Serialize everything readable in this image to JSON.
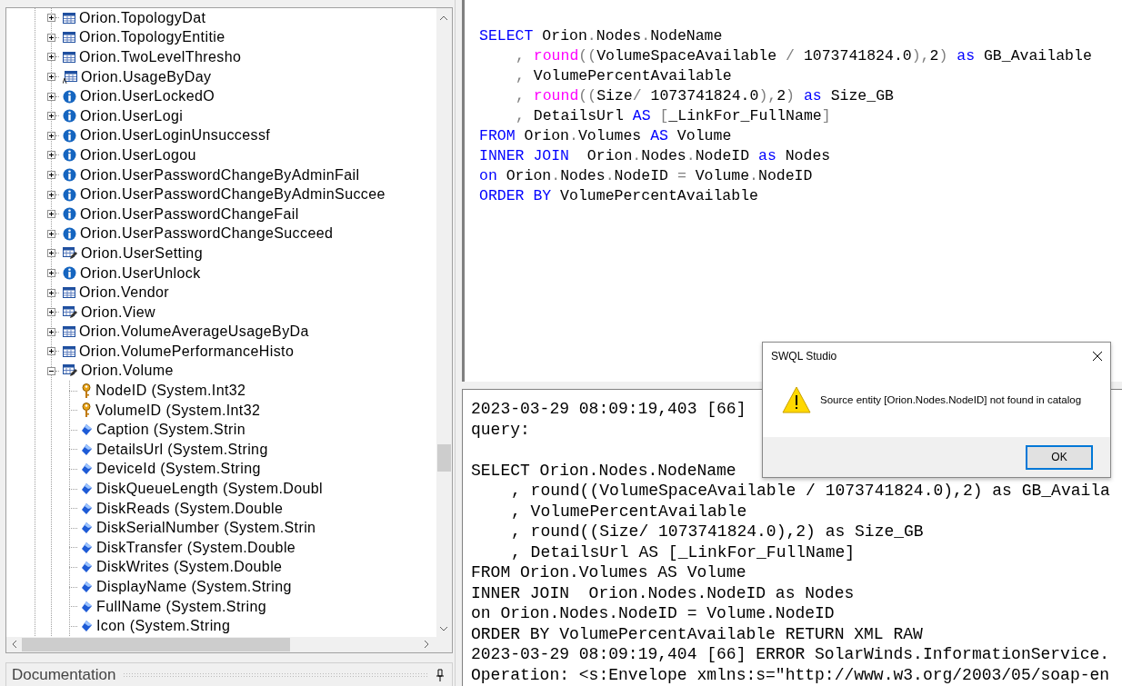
{
  "tree": {
    "items": [
      {
        "label": "Orion.TopologyDat",
        "kind": "table",
        "expanded": false
      },
      {
        "label": "Orion.TopologyEntitie",
        "kind": "table",
        "expanded": false
      },
      {
        "label": "Orion.TwoLevelThresho",
        "kind": "table",
        "expanded": false
      },
      {
        "label": "Orion.UsageByDay",
        "kind": "view",
        "expanded": false
      },
      {
        "label": "Orion.UserLockedO",
        "kind": "info",
        "expanded": false
      },
      {
        "label": "Orion.UserLogi",
        "kind": "info",
        "expanded": false
      },
      {
        "label": "Orion.UserLoginUnsuccessf",
        "kind": "info",
        "expanded": false
      },
      {
        "label": "Orion.UserLogou",
        "kind": "info",
        "expanded": false
      },
      {
        "label": "Orion.UserPasswordChangeByAdminFail",
        "kind": "info",
        "expanded": false
      },
      {
        "label": "Orion.UserPasswordChangeByAdminSuccee",
        "kind": "info",
        "expanded": false
      },
      {
        "label": "Orion.UserPasswordChangeFail",
        "kind": "info",
        "expanded": false
      },
      {
        "label": "Orion.UserPasswordChangeSucceed",
        "kind": "info",
        "expanded": false
      },
      {
        "label": "Orion.UserSetting",
        "kind": "edit",
        "expanded": false
      },
      {
        "label": "Orion.UserUnlock",
        "kind": "info",
        "expanded": false
      },
      {
        "label": "Orion.Vendor",
        "kind": "table",
        "expanded": false
      },
      {
        "label": "Orion.View",
        "kind": "edit",
        "expanded": false
      },
      {
        "label": "Orion.VolumeAverageUsageByDa",
        "kind": "table",
        "expanded": false
      },
      {
        "label": "Orion.VolumePerformanceHisto",
        "kind": "table",
        "expanded": false
      },
      {
        "label": "Orion.Volume",
        "kind": "edit",
        "expanded": true,
        "children": [
          {
            "label": "NodeID (System.Int32",
            "kind": "key"
          },
          {
            "label": "VolumeID (System.Int32",
            "kind": "key"
          },
          {
            "label": "Caption (System.Strin",
            "kind": "property"
          },
          {
            "label": "DetailsUrl (System.String",
            "kind": "property"
          },
          {
            "label": "DeviceId (System.String",
            "kind": "property"
          },
          {
            "label": "DiskQueueLength (System.Doubl",
            "kind": "property"
          },
          {
            "label": "DiskReads (System.Double",
            "kind": "property"
          },
          {
            "label": "DiskSerialNumber (System.Strin",
            "kind": "property"
          },
          {
            "label": "DiskTransfer (System.Double",
            "kind": "property"
          },
          {
            "label": "DiskWrites (System.Double",
            "kind": "property"
          },
          {
            "label": "DisplayName (System.String",
            "kind": "property"
          },
          {
            "label": "FullName (System.String",
            "kind": "property"
          },
          {
            "label": "Icon (System.String",
            "kind": "property"
          }
        ]
      }
    ]
  },
  "documentation": {
    "title": "Documentation"
  },
  "editor": {
    "lines": [
      {
        "indented": false,
        "tokens": [
          {
            "kind": "kw",
            "text": "SELECT"
          },
          {
            "kind": "id",
            "text": " Orion"
          },
          {
            "kind": "op",
            "text": "."
          },
          {
            "kind": "id",
            "text": "Nodes"
          },
          {
            "kind": "op",
            "text": "."
          },
          {
            "kind": "id",
            "text": "NodeName"
          }
        ]
      },
      {
        "indented": true,
        "tokens": [
          {
            "kind": "op",
            "text": ", "
          },
          {
            "kind": "fn",
            "text": "round"
          },
          {
            "kind": "op",
            "text": "(("
          },
          {
            "kind": "id",
            "text": "VolumeSpaceAvailable "
          },
          {
            "kind": "op",
            "text": "/"
          },
          {
            "kind": "id",
            "text": " 1073741824.0"
          },
          {
            "kind": "op",
            "text": "),"
          },
          {
            "kind": "id",
            "text": "2"
          },
          {
            "kind": "op",
            "text": ")"
          },
          {
            "kind": "kw",
            "text": " as"
          },
          {
            "kind": "id",
            "text": " GB_Available"
          }
        ]
      },
      {
        "indented": true,
        "tokens": [
          {
            "kind": "op",
            "text": ", "
          },
          {
            "kind": "id",
            "text": "VolumePercentAvailable"
          }
        ]
      },
      {
        "indented": true,
        "tokens": [
          {
            "kind": "op",
            "text": ", "
          },
          {
            "kind": "fn",
            "text": "round"
          },
          {
            "kind": "op",
            "text": "(("
          },
          {
            "kind": "id",
            "text": "Size"
          },
          {
            "kind": "op",
            "text": "/"
          },
          {
            "kind": "id",
            "text": " 1073741824.0"
          },
          {
            "kind": "op",
            "text": "),"
          },
          {
            "kind": "id",
            "text": "2"
          },
          {
            "kind": "op",
            "text": ")"
          },
          {
            "kind": "kw",
            "text": " as"
          },
          {
            "kind": "id",
            "text": " Size_GB"
          }
        ]
      },
      {
        "indented": true,
        "tokens": [
          {
            "kind": "op",
            "text": ", "
          },
          {
            "kind": "id",
            "text": "DetailsUrl "
          },
          {
            "kind": "kw",
            "text": "AS"
          },
          {
            "kind": "op",
            "text": " ["
          },
          {
            "kind": "id",
            "text": "_LinkFor_FullName"
          },
          {
            "kind": "op",
            "text": "]"
          }
        ]
      },
      {
        "indented": false,
        "tokens": [
          {
            "kind": "kw",
            "text": "FROM"
          },
          {
            "kind": "id",
            "text": " Orion"
          },
          {
            "kind": "op",
            "text": "."
          },
          {
            "kind": "id",
            "text": "Volumes "
          },
          {
            "kind": "kw",
            "text": "AS"
          },
          {
            "kind": "id",
            "text": " Volume"
          }
        ]
      },
      {
        "indented": false,
        "tokens": [
          {
            "kind": "kw",
            "text": "INNER JOIN"
          },
          {
            "kind": "id",
            "text": "  Orion"
          },
          {
            "kind": "op",
            "text": "."
          },
          {
            "kind": "id",
            "text": "Nodes"
          },
          {
            "kind": "op",
            "text": "."
          },
          {
            "kind": "id",
            "text": "NodeID "
          },
          {
            "kind": "kw",
            "text": "as"
          },
          {
            "kind": "id",
            "text": " Nodes"
          }
        ]
      },
      {
        "indented": false,
        "tokens": [
          {
            "kind": "kw",
            "text": "on"
          },
          {
            "kind": "id",
            "text": " Orion"
          },
          {
            "kind": "op",
            "text": "."
          },
          {
            "kind": "id",
            "text": "Nodes"
          },
          {
            "kind": "op",
            "text": "."
          },
          {
            "kind": "id",
            "text": "NodeID "
          },
          {
            "kind": "op",
            "text": "="
          },
          {
            "kind": "id",
            "text": " Volume"
          },
          {
            "kind": "op",
            "text": "."
          },
          {
            "kind": "id",
            "text": "NodeID"
          }
        ]
      },
      {
        "indented": false,
        "tokens": [
          {
            "kind": "kw",
            "text": "ORDER BY"
          },
          {
            "kind": "id",
            "text": " VolumePercentAvailable"
          }
        ]
      }
    ]
  },
  "log": {
    "lines": [
      {
        "text": "2023-03-29 08:09:19,403 [66]",
        "indented": false
      },
      {
        "text": "query:",
        "indented": false
      },
      {
        "text": "SELECT Orion.Nodes.NodeName",
        "indented": false,
        "blank_before": true
      },
      {
        "text": ", round((VolumeSpaceAvailable / 1073741824.0),2) as GB_Availa",
        "indented": true
      },
      {
        "text": ", VolumePercentAvailable",
        "indented": true
      },
      {
        "text": ", round((Size/ 1073741824.0),2) as Size_GB",
        "indented": true
      },
      {
        "text": ", DetailsUrl AS [_LinkFor_FullName]",
        "indented": true
      },
      {
        "text": "FROM Orion.Volumes AS Volume",
        "indented": false
      },
      {
        "text": "INNER JOIN  Orion.Nodes.NodeID as Nodes",
        "indented": false
      },
      {
        "text": "on Orion.Nodes.NodeID = Volume.NodeID",
        "indented": false
      },
      {
        "text": "ORDER BY VolumePercentAvailable RETURN XML RAW",
        "indented": false
      },
      {
        "text": "2023-03-29 08:09:19,404 [66] ERROR SolarWinds.InformationService.",
        "indented": false
      },
      {
        "text": "Operation: <s:Envelope xmlns:s=\"http://www.w3.org/2003/05/soap-en",
        "indented": false
      }
    ]
  },
  "dialog": {
    "title": "SWQL Studio",
    "kind": "warning",
    "message": "Source entity [Orion.Nodes.NodeID] not found in catalog",
    "buttons": [
      {
        "label": "OK",
        "default": true
      }
    ]
  }
}
